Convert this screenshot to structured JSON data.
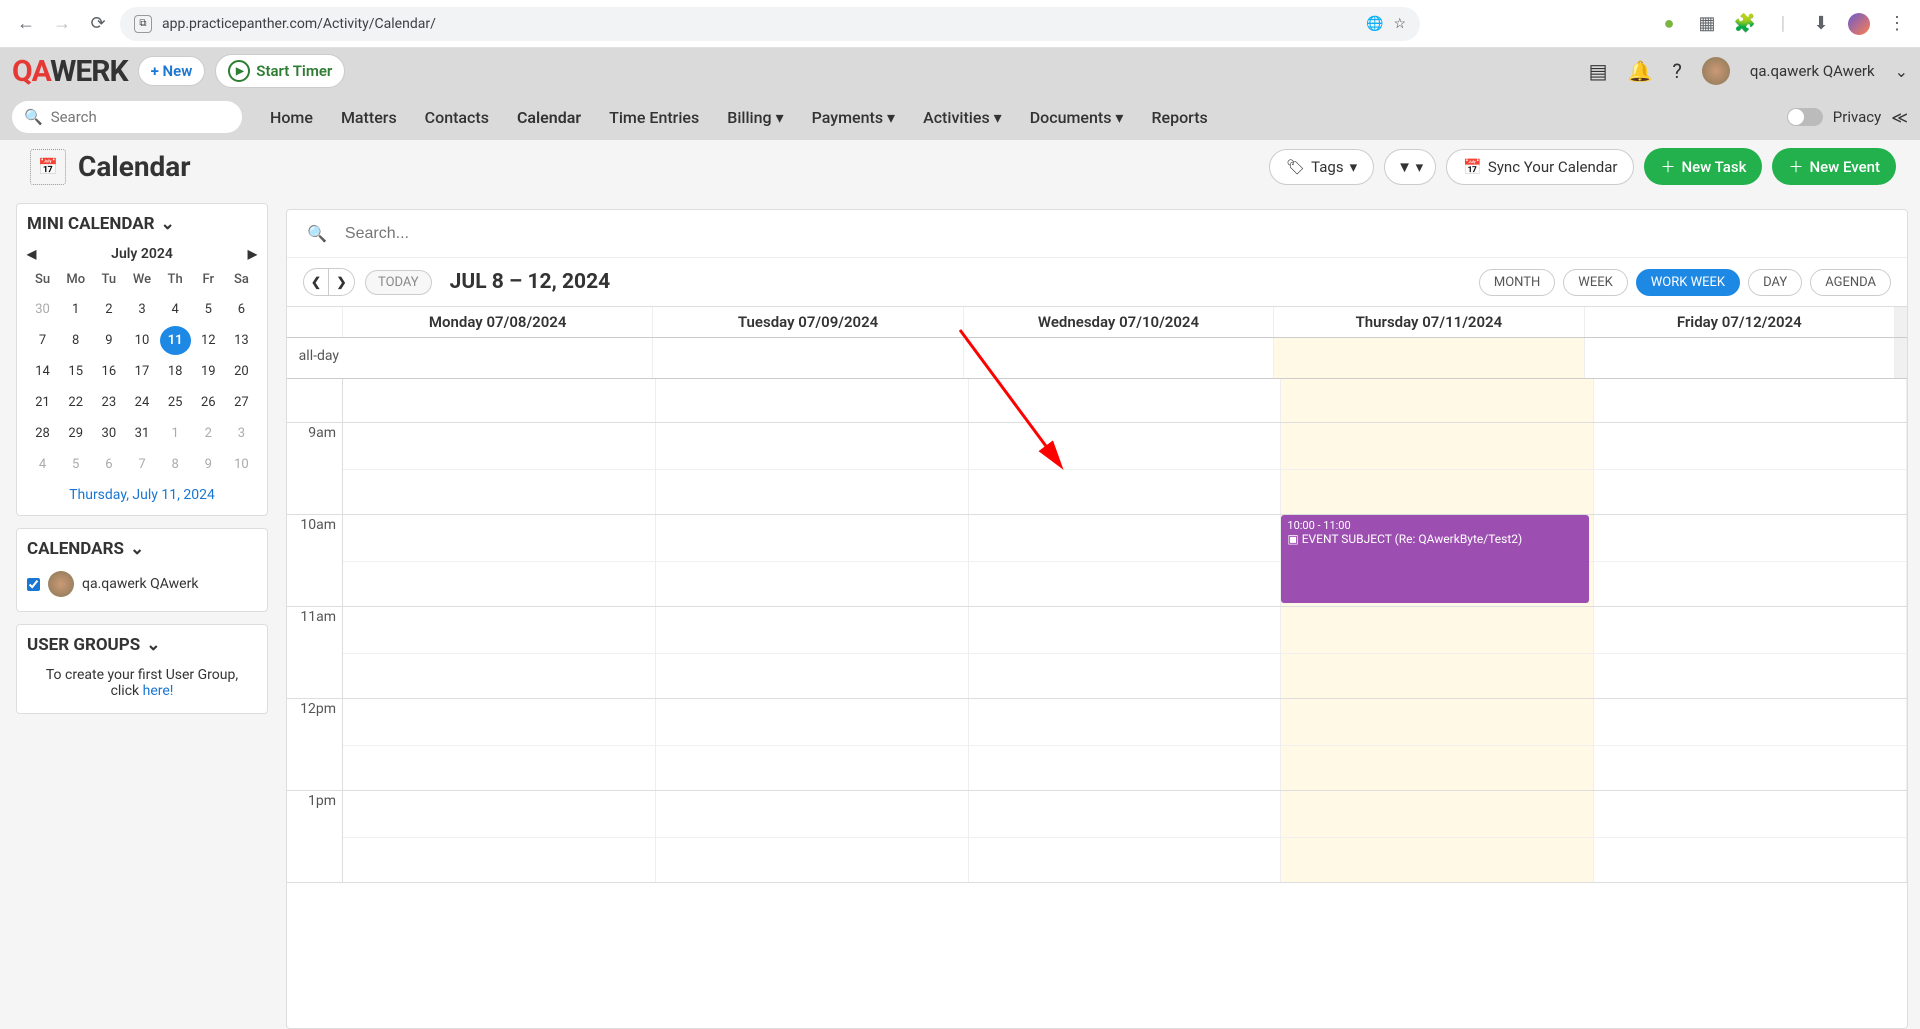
{
  "browser": {
    "url": "app.practicepanther.com/Activity/Calendar/"
  },
  "header": {
    "logo_prefix": "QA",
    "logo_suffix": "WERK",
    "new_button": "+ New",
    "start_timer": "Start Timer",
    "user_name": "qa.qawerk QAwerk",
    "privacy_label": "Privacy"
  },
  "nav": {
    "items": [
      "Home",
      "Matters",
      "Contacts",
      "Calendar",
      "Time Entries",
      "Billing ▾",
      "Payments ▾",
      "Activities ▾",
      "Documents ▾",
      "Reports"
    ],
    "search_placeholder": "Search"
  },
  "page": {
    "title": "Calendar",
    "tags_button": "Tags",
    "sync_button": "Sync Your Calendar",
    "new_task": "New Task",
    "new_event": "New Event"
  },
  "mini_calendar": {
    "title": "MINI CALENDAR",
    "month_label": "July 2024",
    "footer": "Thursday, July 11, 2024",
    "dow": [
      "Su",
      "Mo",
      "Tu",
      "We",
      "Th",
      "Fr",
      "Sa"
    ],
    "days": [
      {
        "n": "30",
        "other": true
      },
      {
        "n": "1"
      },
      {
        "n": "2"
      },
      {
        "n": "3"
      },
      {
        "n": "4"
      },
      {
        "n": "5"
      },
      {
        "n": "6"
      },
      {
        "n": "7"
      },
      {
        "n": "8"
      },
      {
        "n": "9"
      },
      {
        "n": "10"
      },
      {
        "n": "11",
        "today": true
      },
      {
        "n": "12"
      },
      {
        "n": "13"
      },
      {
        "n": "14"
      },
      {
        "n": "15"
      },
      {
        "n": "16"
      },
      {
        "n": "17"
      },
      {
        "n": "18"
      },
      {
        "n": "19"
      },
      {
        "n": "20"
      },
      {
        "n": "21"
      },
      {
        "n": "22"
      },
      {
        "n": "23"
      },
      {
        "n": "24"
      },
      {
        "n": "25"
      },
      {
        "n": "26"
      },
      {
        "n": "27"
      },
      {
        "n": "28"
      },
      {
        "n": "29"
      },
      {
        "n": "30"
      },
      {
        "n": "31"
      },
      {
        "n": "1",
        "other": true
      },
      {
        "n": "2",
        "other": true
      },
      {
        "n": "3",
        "other": true
      },
      {
        "n": "4",
        "other": true
      },
      {
        "n": "5",
        "other": true
      },
      {
        "n": "6",
        "other": true
      },
      {
        "n": "7",
        "other": true
      },
      {
        "n": "8",
        "other": true
      },
      {
        "n": "9",
        "other": true
      },
      {
        "n": "10",
        "other": true
      }
    ]
  },
  "calendars_panel": {
    "title": "CALENDARS",
    "user": "qa.qawerk QAwerk"
  },
  "user_groups_panel": {
    "title": "USER GROUPS",
    "text": "To create your first User Group, click ",
    "link": "here!"
  },
  "calendar_main": {
    "search_placeholder": "Search...",
    "today_label": "TODAY",
    "date_range": "JUL 8 – 12, 2024",
    "views": [
      "MONTH",
      "WEEK",
      "WORK WEEK",
      "DAY",
      "AGENDA"
    ],
    "active_view": "WORK WEEK",
    "allday_label": "all-day",
    "day_headers": [
      "Monday 07/08/2024",
      "Tuesday 07/09/2024",
      "Wednesday 07/10/2024",
      "Thursday 07/11/2024",
      "Friday 07/12/2024"
    ],
    "time_labels": [
      "",
      "9am",
      "10am",
      "11am",
      "12pm",
      "1pm"
    ],
    "today_index": 3,
    "event": {
      "time": "10:00 - 11:00",
      "title": "EVENT SUBJECT (Re: QAwerkByte/Test2)"
    }
  }
}
